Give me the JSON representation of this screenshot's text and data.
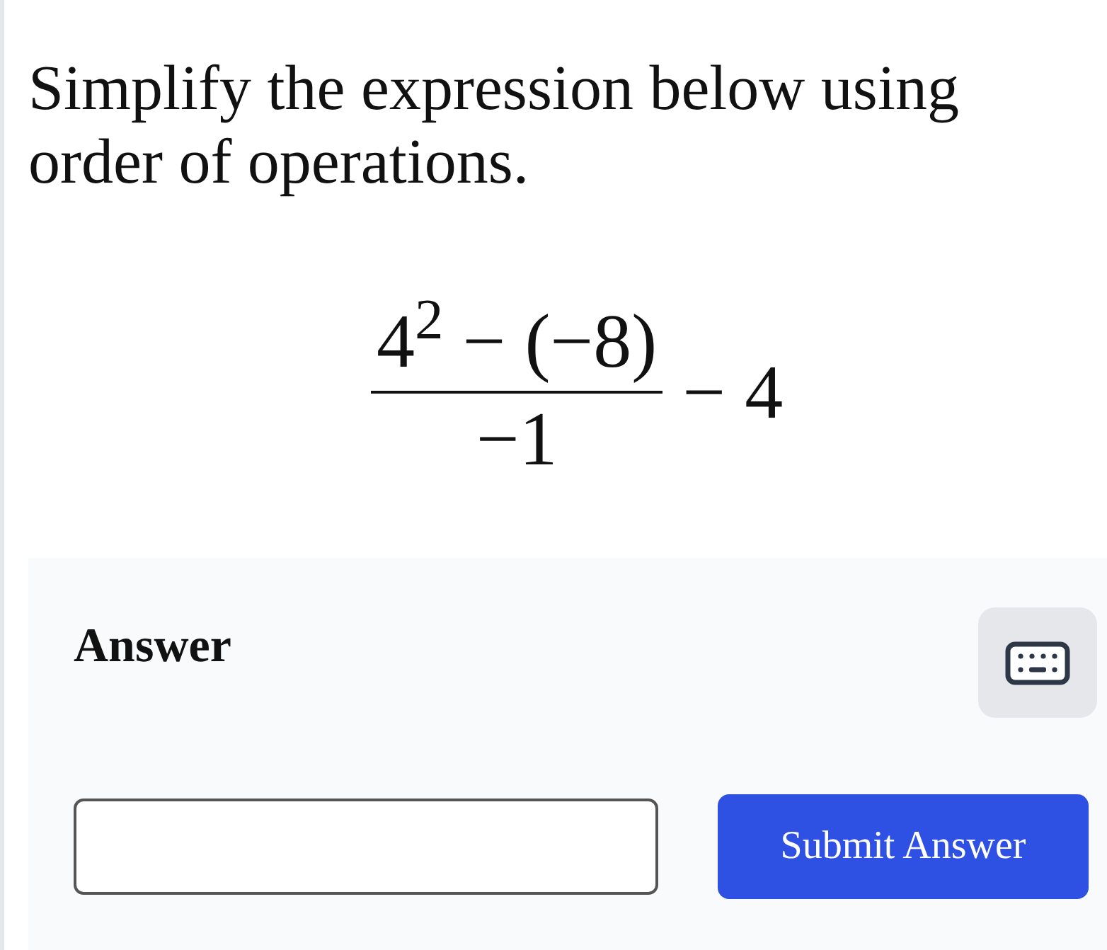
{
  "question": {
    "text": "Simplify the expression below using order of operations."
  },
  "expression": {
    "numerator": "4$^{2}$ − (−8)",
    "denominator": "−1",
    "tail": "− 4"
  },
  "answer_panel": {
    "heading": "Answer",
    "submit_button": {
      "label": "Submit Answer"
    }
  }
}
